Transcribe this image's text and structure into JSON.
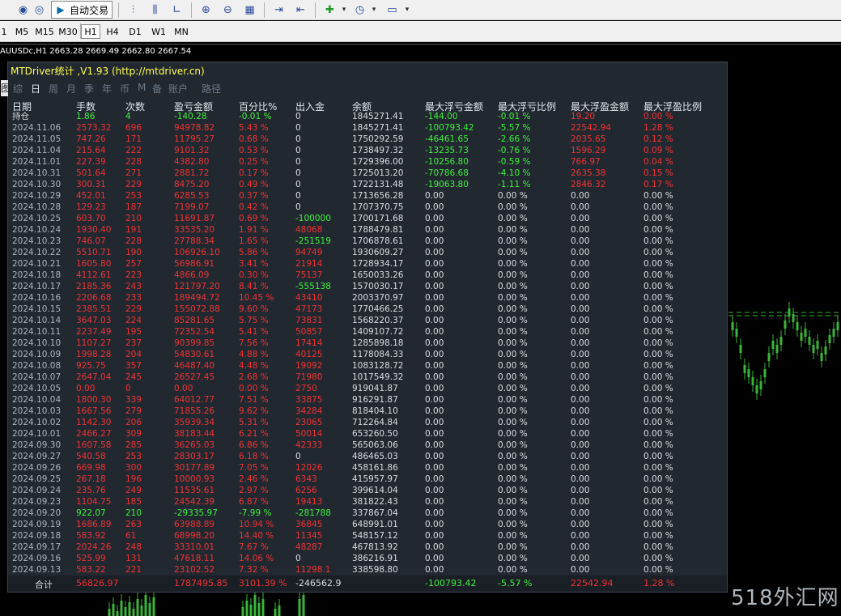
{
  "toolbar": {
    "auto_trade_label": "自动交易",
    "timeframes": [
      "1",
      "M5",
      "M15",
      "M30",
      "H1",
      "H4",
      "D1",
      "W1",
      "MN"
    ],
    "selected_timeframe": "H1"
  },
  "chart": {
    "info": "AUUSDc,H1  2663.28 2669.49 2662.80 2667.54",
    "candle_color": "#3ab53a"
  },
  "panel": {
    "title": "MTDriver统计 ,V1.93 (http://mtdriver.cn)",
    "edge_label": "图",
    "tabs": [
      "综",
      "日",
      "周",
      "月",
      "季",
      "年",
      "币",
      "M",
      "备",
      "账户",
      "路径"
    ],
    "active_tab": "日",
    "columns": [
      "日期",
      "手数",
      "次数",
      "盈亏金额",
      "百分比%",
      "出入金",
      "余额",
      "最大浮亏金额",
      "最大浮亏比例",
      "最大浮盈金额",
      "最大浮盈比例"
    ],
    "rows": [
      [
        "持仓",
        "1.86",
        "4",
        "-140.28",
        "-0.01 %",
        "0",
        "1845271.41",
        "-144.00",
        "-0.01 %",
        "19.20",
        "0.00 %"
      ],
      [
        "2024.11.06",
        "2573.32",
        "696",
        "94978.82",
        "5.43 %",
        "0",
        "1845271.41",
        "-100793.42",
        "-5.57 %",
        "22542.94",
        "1.28 %"
      ],
      [
        "2024.11.05",
        "747.26",
        "171",
        "11795.27",
        "0.68 %",
        "0",
        "1750292.59",
        "-46461.65",
        "-2.66 %",
        "2035.65",
        "0.12 %"
      ],
      [
        "2024.11.04",
        "215.64",
        "222",
        "9101.32",
        "0.53 %",
        "0",
        "1738497.32",
        "-13235.73",
        "-0.76 %",
        "1596.29",
        "0.09 %"
      ],
      [
        "2024.11.01",
        "227.39",
        "228",
        "4382.80",
        "0.25 %",
        "0",
        "1729396.00",
        "-10256.80",
        "-0.59 %",
        "766.97",
        "0.04 %"
      ],
      [
        "2024.10.31",
        "501.64",
        "271",
        "2881.72",
        "0.17 %",
        "0",
        "1725013.20",
        "-70786.68",
        "-4.10 %",
        "2635.38",
        "0.15 %"
      ],
      [
        "2024.10.30",
        "300.31",
        "229",
        "8475.20",
        "0.49 %",
        "0",
        "1722131.48",
        "-19063.80",
        "-1.11 %",
        "2846.32",
        "0.17 %"
      ],
      [
        "2024.10.29",
        "452.01",
        "253",
        "6285.53",
        "0.37 %",
        "0",
        "1713656.28",
        "0.00",
        "0.00 %",
        "0.00",
        "0.00 %"
      ],
      [
        "2024.10.28",
        "129.23",
        "187",
        "7199.07",
        "0.42 %",
        "0",
        "1707370.75",
        "0.00",
        "0.00 %",
        "0.00",
        "0.00 %"
      ],
      [
        "2024.10.25",
        "603.70",
        "210",
        "11691.87",
        "0.69 %",
        "-100000",
        "1700171.68",
        "0.00",
        "0.00 %",
        "0.00",
        "0.00 %"
      ],
      [
        "2024.10.24",
        "1930.40",
        "191",
        "33535.20",
        "1.91 %",
        "48068",
        "1788479.81",
        "0.00",
        "0.00 %",
        "0.00",
        "0.00 %"
      ],
      [
        "2024.10.23",
        "746.07",
        "228",
        "27788.34",
        "1.65 %",
        "-251519",
        "1706878.61",
        "0.00",
        "0.00 %",
        "0.00",
        "0.00 %"
      ],
      [
        "2024.10.22",
        "5510.71",
        "190",
        "106926.10",
        "5.86 %",
        "94749",
        "1930609.27",
        "0.00",
        "0.00 %",
        "0.00",
        "0.00 %"
      ],
      [
        "2024.10.21",
        "1605.80",
        "257",
        "56986.91",
        "3.41 %",
        "21914",
        "1728934.17",
        "0.00",
        "0.00 %",
        "0.00",
        "0.00 %"
      ],
      [
        "2024.10.18",
        "4112.61",
        "223",
        "4866.09",
        "0.30 %",
        "75137",
        "1650033.26",
        "0.00",
        "0.00 %",
        "0.00",
        "0.00 %"
      ],
      [
        "2024.10.17",
        "2185.36",
        "243",
        "121797.20",
        "8.41 %",
        "-555138",
        "1570030.17",
        "0.00",
        "0.00 %",
        "0.00",
        "0.00 %"
      ],
      [
        "2024.10.16",
        "2206.68",
        "233",
        "189494.72",
        "10.45 %",
        "43410",
        "2003370.97",
        "0.00",
        "0.00 %",
        "0.00",
        "0.00 %"
      ],
      [
        "2024.10.15",
        "2385.51",
        "229",
        "155072.88",
        "9.60 %",
        "47173",
        "1770466.25",
        "0.00",
        "0.00 %",
        "0.00",
        "0.00 %"
      ],
      [
        "2024.10.14",
        "3647.03",
        "224",
        "85281.65",
        "5.75 %",
        "73831",
        "1568220.37",
        "0.00",
        "0.00 %",
        "0.00",
        "0.00 %"
      ],
      [
        "2024.10.11",
        "2237.49",
        "195",
        "72352.54",
        "5.41 %",
        "50857",
        "1409107.72",
        "0.00",
        "0.00 %",
        "0.00",
        "0.00 %"
      ],
      [
        "2024.10.10",
        "1107.27",
        "237",
        "90399.85",
        "7.56 %",
        "17414",
        "1285898.18",
        "0.00",
        "0.00 %",
        "0.00",
        "0.00 %"
      ],
      [
        "2024.10.09",
        "1998.28",
        "204",
        "54830.61",
        "4.88 %",
        "40125",
        "1178084.33",
        "0.00",
        "0.00 %",
        "0.00",
        "0.00 %"
      ],
      [
        "2024.10.08",
        "925.75",
        "357",
        "46487.40",
        "4.48 %",
        "19092",
        "1083128.72",
        "0.00",
        "0.00 %",
        "0.00",
        "0.00 %"
      ],
      [
        "2024.10.07",
        "2647.04",
        "245",
        "26527.45",
        "2.68 %",
        "71980",
        "1017549.32",
        "0.00",
        "0.00 %",
        "0.00",
        "0.00 %"
      ],
      [
        "2024.10.05",
        "0.00",
        "0",
        "0.00",
        "0.00 %",
        "2750",
        "919041.87",
        "0.00",
        "0.00 %",
        "0.00",
        "0.00 %"
      ],
      [
        "2024.10.04",
        "1800.30",
        "339",
        "64012.77",
        "7.51 %",
        "33875",
        "916291.87",
        "0.00",
        "0.00 %",
        "0.00",
        "0.00 %"
      ],
      [
        "2024.10.03",
        "1667.56",
        "279",
        "71855.26",
        "9.62 %",
        "34284",
        "818404.10",
        "0.00",
        "0.00 %",
        "0.00",
        "0.00 %"
      ],
      [
        "2024.10.02",
        "1142.30",
        "206",
        "35939.34",
        "5.31 %",
        "23065",
        "712264.84",
        "0.00",
        "0.00 %",
        "0.00",
        "0.00 %"
      ],
      [
        "2024.10.01",
        "2466.27",
        "309",
        "38183.44",
        "6.21 %",
        "50014",
        "653260.50",
        "0.00",
        "0.00 %",
        "0.00",
        "0.00 %"
      ],
      [
        "2024.09.30",
        "1607.58",
        "285",
        "36265.03",
        "6.86 %",
        "42333",
        "565063.06",
        "0.00",
        "0.00 %",
        "0.00",
        "0.00 %"
      ],
      [
        "2024.09.27",
        "540.58",
        "253",
        "28303.17",
        "6.18 %",
        "0",
        "486465.03",
        "0.00",
        "0.00 %",
        "0.00",
        "0.00 %"
      ],
      [
        "2024.09.26",
        "669.98",
        "300",
        "30177.89",
        "7.05 %",
        "12026",
        "458161.86",
        "0.00",
        "0.00 %",
        "0.00",
        "0.00 %"
      ],
      [
        "2024.09.25",
        "267.18",
        "196",
        "10000.93",
        "2.46 %",
        "6343",
        "415957.97",
        "0.00",
        "0.00 %",
        "0.00",
        "0.00 %"
      ],
      [
        "2024.09.24",
        "235.76",
        "249",
        "11535.61",
        "2.97 %",
        "6256",
        "399614.04",
        "0.00",
        "0.00 %",
        "0.00",
        "0.00 %"
      ],
      [
        "2024.09.23",
        "1104.75",
        "185",
        "24542.39",
        "6.87 %",
        "19413",
        "381822.43",
        "0.00",
        "0.00 %",
        "0.00",
        "0.00 %"
      ],
      [
        "2024.09.20",
        "922.07",
        "210",
        "-29335.97",
        "-7.99 %",
        "-281788",
        "337867.04",
        "0.00",
        "0.00 %",
        "0.00",
        "0.00 %"
      ],
      [
        "2024.09.19",
        "1686.89",
        "263",
        "63988.89",
        "10.94 %",
        "36845",
        "648991.01",
        "0.00",
        "0.00 %",
        "0.00",
        "0.00 %"
      ],
      [
        "2024.09.18",
        "583.92",
        "61",
        "68998.20",
        "14.40 %",
        "11345",
        "548157.12",
        "0.00",
        "0.00 %",
        "0.00",
        "0.00 %"
      ],
      [
        "2024.09.17",
        "2024.26",
        "248",
        "33310.01",
        "7.67 %",
        "48287",
        "467813.92",
        "0.00",
        "0.00 %",
        "0.00",
        "0.00 %"
      ],
      [
        "2024.09.16",
        "525.99",
        "131",
        "47618.11",
        "14.06 %",
        "0",
        "386216.91",
        "0.00",
        "0.00 %",
        "0.00",
        "0.00 %"
      ],
      [
        "2024.09.13",
        "583.22",
        "221",
        "23102.52",
        "7.32 %",
        "11298.1",
        "338598.80",
        "0.00",
        "0.00 %",
        "0.00",
        "0.00 %"
      ]
    ],
    "footer": {
      "label": "合计",
      "lots": "56826.97",
      "pnl": "1787495.85",
      "pct": "3101.39 %",
      "flow": "-246562.9",
      "max_dd_amt": "-100793.42",
      "max_dd_pct": "-5.57 %",
      "max_fp_amt": "22542.94",
      "max_fp_pct": "1.28 %"
    }
  },
  "watermark": "518外汇网"
}
